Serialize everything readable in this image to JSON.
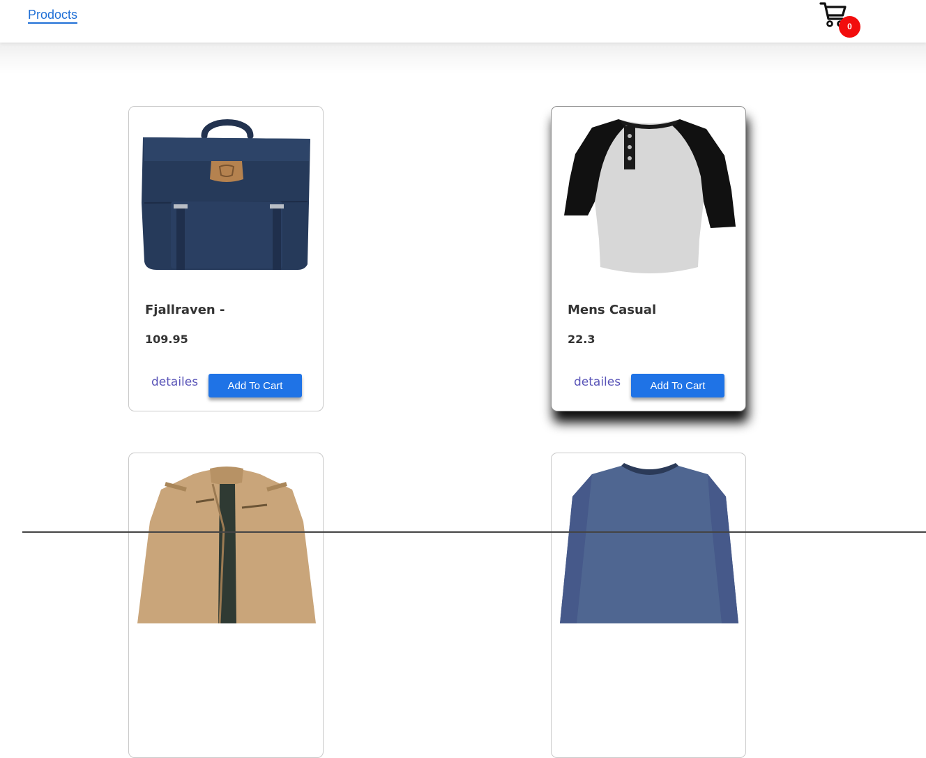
{
  "nav": {
    "products_label": "Prodocts",
    "cart_count": "0",
    "cart_icon": "cart-icon"
  },
  "products": [
    {
      "title": "Fjallraven -",
      "price": "109.95",
      "details_label": "detailes",
      "add_label": "Add To Cart",
      "image": "backpack"
    },
    {
      "title": "Mens Casual",
      "price": "22.3",
      "details_label": "detailes",
      "add_label": "Add To Cart",
      "image": "raglan-tshirt"
    },
    {
      "title": "",
      "price": "",
      "details_label": "",
      "add_label": "",
      "image": "cotton-jacket"
    },
    {
      "title": "",
      "price": "",
      "details_label": "",
      "add_label": "",
      "image": "slim-fit-tshirt"
    }
  ],
  "colors": {
    "link": "#1f6fd6",
    "button": "#1f73e6",
    "badge": "#f20d0d",
    "details": "#5a55b8"
  }
}
